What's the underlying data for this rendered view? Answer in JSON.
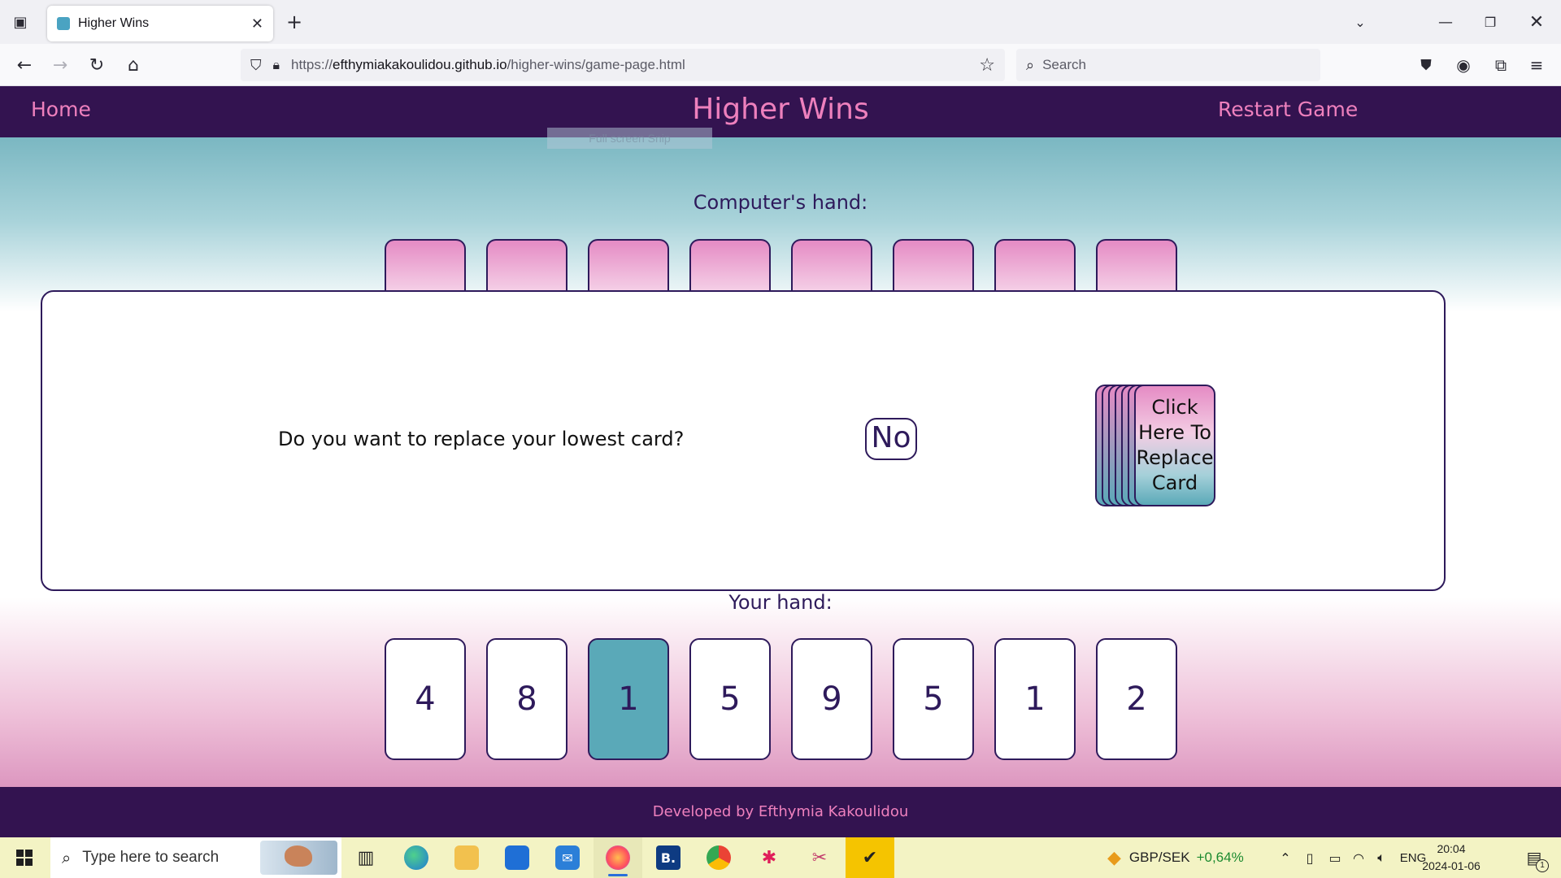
{
  "browser": {
    "tab_title": "Higher Wins",
    "url_prefix": "https://",
    "url_domain": "efthymiakakoulidou.github.io",
    "url_path": "/higher-wins/game-page.html",
    "search_placeholder": "Search"
  },
  "site": {
    "home_link": "Home",
    "title": "Higher Wins",
    "restart_link": "Restart Game",
    "ghost_overlay": "Full screen Snip",
    "footer": "Developed by Efthymia Kakoulidou"
  },
  "game": {
    "computer_label": "Computer's hand:",
    "computer_card_count": 8,
    "question": "Do you want to replace your lowest card?",
    "no_button": "No",
    "deck_label": "Click Here To Replace Card",
    "your_label": "Your hand:",
    "player_cards": [
      "4",
      "8",
      "1",
      "5",
      "9",
      "5",
      "1",
      "2"
    ],
    "selected_card_index": 2
  },
  "colors": {
    "header_bg": "#331350",
    "header_text": "#ee80bd",
    "text_dark": "#2e1a5b",
    "selected_card": "#5aa9b8",
    "card_pink": "#e58bc4"
  },
  "taskbar": {
    "search_placeholder": "Type here to search",
    "ticker_pair": "GBP/SEK",
    "ticker_change": "+0,64%",
    "language": "ENG",
    "time": "20:04",
    "date": "2024-01-06",
    "notification_count": "1",
    "apps": [
      "task-view-icon",
      "edge-icon",
      "file-explorer-icon",
      "store-icon",
      "mail-icon",
      "firefox-icon",
      "booking-icon",
      "chrome-icon",
      "slack-icon",
      "snipping-tool-icon",
      "tasks-icon"
    ]
  }
}
